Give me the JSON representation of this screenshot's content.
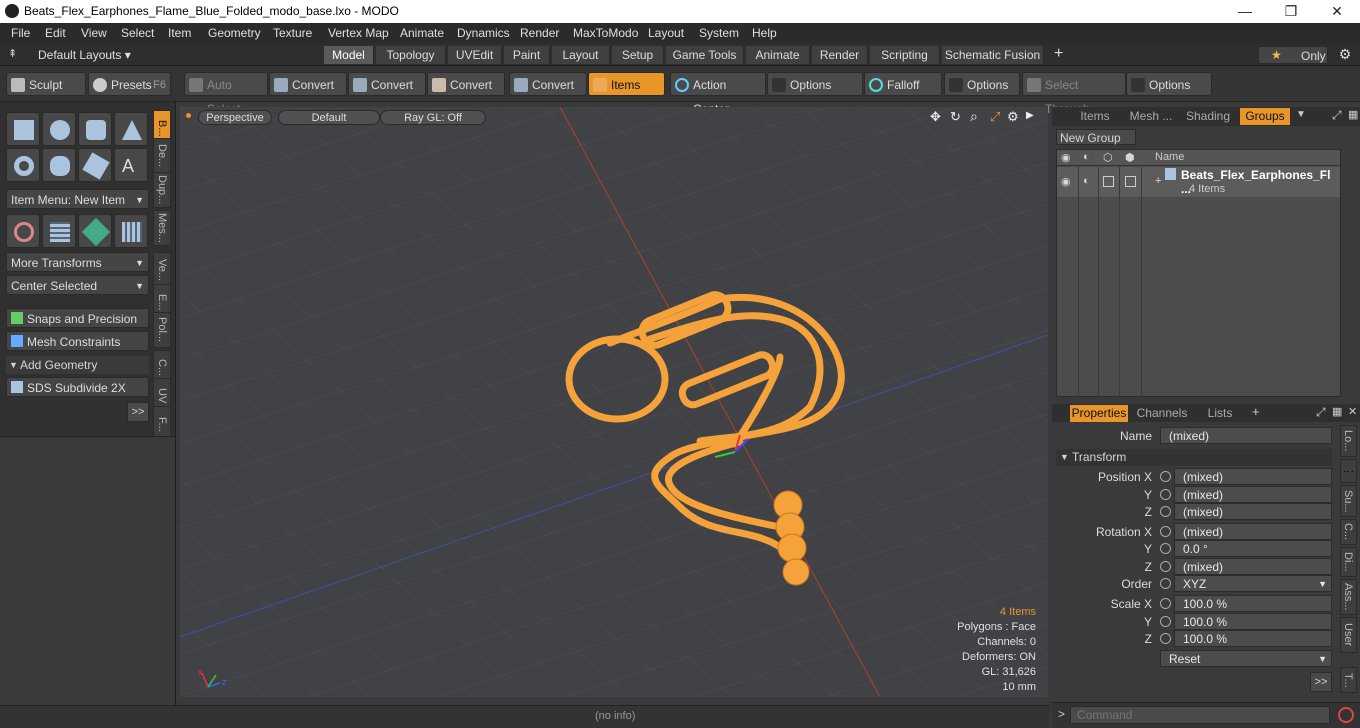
{
  "window": {
    "title": "Beats_Flex_Earphones_Flame_Blue_Folded_modo_base.lxo - MODO",
    "minimize": "—",
    "maximize": "❐",
    "close": "✕"
  },
  "menu": [
    "File",
    "Edit",
    "View",
    "Select",
    "Item",
    "Geometry",
    "Texture",
    "Vertex Map",
    "Animate",
    "Dynamics",
    "Render",
    "MaxToModo",
    "Layout",
    "System",
    "Help"
  ],
  "layouts": {
    "label": "Default Layouts ▾",
    "star_only": "Only",
    "plus": "+"
  },
  "tabs": [
    "Model",
    "Topology",
    "UVEdit",
    "Paint",
    "Layout",
    "Setup",
    "Game Tools",
    "Animate",
    "Render",
    "Scripting",
    "Schematic Fusion"
  ],
  "active_tab": "Model",
  "toolbar": {
    "sculpt": "Sculpt",
    "presets": "Presets",
    "presets_key": "F6",
    "auto_select": "Auto Select",
    "convert1": "Convert",
    "convert2": "Convert",
    "convert3": "Convert",
    "convert4": "Convert",
    "items": "Items",
    "action_center": "Action Center",
    "options1": "Options",
    "falloff": "Falloff",
    "options2": "Options",
    "select_through": "Select Through",
    "options3": "Options"
  },
  "left": {
    "item_menu": "Item Menu: New Item",
    "more_transforms": "More Transforms",
    "center_selected": "Center Selected",
    "snaps": "Snaps and Precision",
    "mesh_constraints": "Mesh Constraints",
    "add_geometry": "Add Geometry",
    "sds": "SDS Subdivide 2X",
    "more": ">>",
    "vtabs": [
      "B...",
      "De...",
      "Dup...",
      "Mes...",
      "Ve...",
      "E...",
      "Pol...",
      "C...",
      "UV",
      "F..."
    ]
  },
  "viewport": {
    "perspective": "Perspective",
    "shading": "Default",
    "raygl": "Ray GL: Off",
    "info": {
      "items": "4 Items",
      "polygons": "Polygons : Face",
      "channels": "Channels: 0",
      "deformers": "Deformers: ON",
      "gl": "GL: 31,626",
      "unit": "10 mm"
    }
  },
  "status": {
    "no_info": "(no info)"
  },
  "right": {
    "tabs_top": [
      "Items",
      "Mesh ...",
      "Shading",
      "Groups"
    ],
    "active_top": "Groups",
    "new_group": "New Group",
    "col_name": "Name",
    "group_name": "Beats_Flex_Earphones_Fl ...",
    "group_count": "4 Items",
    "tabs_props": [
      "Properties",
      "Channels",
      "Lists"
    ],
    "name_label": "Name",
    "name_value": "(mixed)",
    "transform": "Transform",
    "position_x_label": "Position X",
    "y_label": "Y",
    "z_label": "Z",
    "pos_x": "(mixed)",
    "pos_y": "(mixed)",
    "pos_z": "(mixed)",
    "rotation_x_label": "Rotation X",
    "rot_x": "(mixed)",
    "rot_y": "0.0 °",
    "rot_z": "(mixed)",
    "order_label": "Order",
    "order_value": "XYZ",
    "scale_x_label": "Scale X",
    "scl_x": "100.0 %",
    "scl_y": "100.0 %",
    "scl_z": "100.0 %",
    "reset": "Reset",
    "more": ">>",
    "side_tabs": [
      "Lo...",
      "Su...",
      "C...",
      "Di...",
      "Ass...",
      "User",
      "T..."
    ],
    "command_placeholder": "Command"
  },
  "colors": {
    "accent": "#e8962a",
    "wire": "#f5a23a"
  }
}
